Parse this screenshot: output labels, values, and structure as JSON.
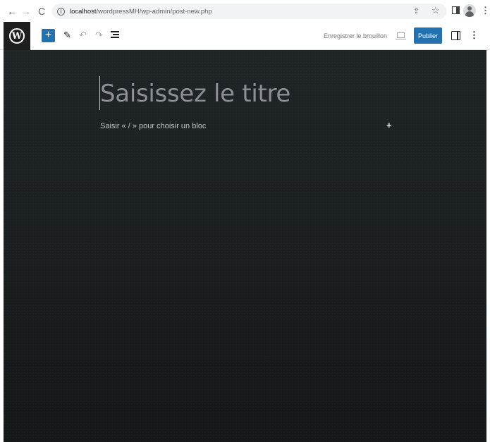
{
  "browser": {
    "back": "←",
    "forward": "→",
    "reload": "C",
    "info": "i",
    "url_host": "localhost",
    "url_path": "/wordpressMH/wp-admin/post-new.php",
    "share": "⇪",
    "star": "☆",
    "menu": "⋮"
  },
  "toolbar": {
    "logo": "W",
    "add_block": "+",
    "tools": "✎",
    "undo": "↶",
    "redo": "↷",
    "save_draft": "Enregistrer le brouillon",
    "publish": "Publier",
    "options": "⋮"
  },
  "editor": {
    "title_placeholder": "Saisissez le titre",
    "block_hint": "Saisir « / » pour choisir un bloc",
    "inline_add": "+"
  },
  "colors": {
    "accent": "#2271b1",
    "canvas": "#1c2123"
  }
}
